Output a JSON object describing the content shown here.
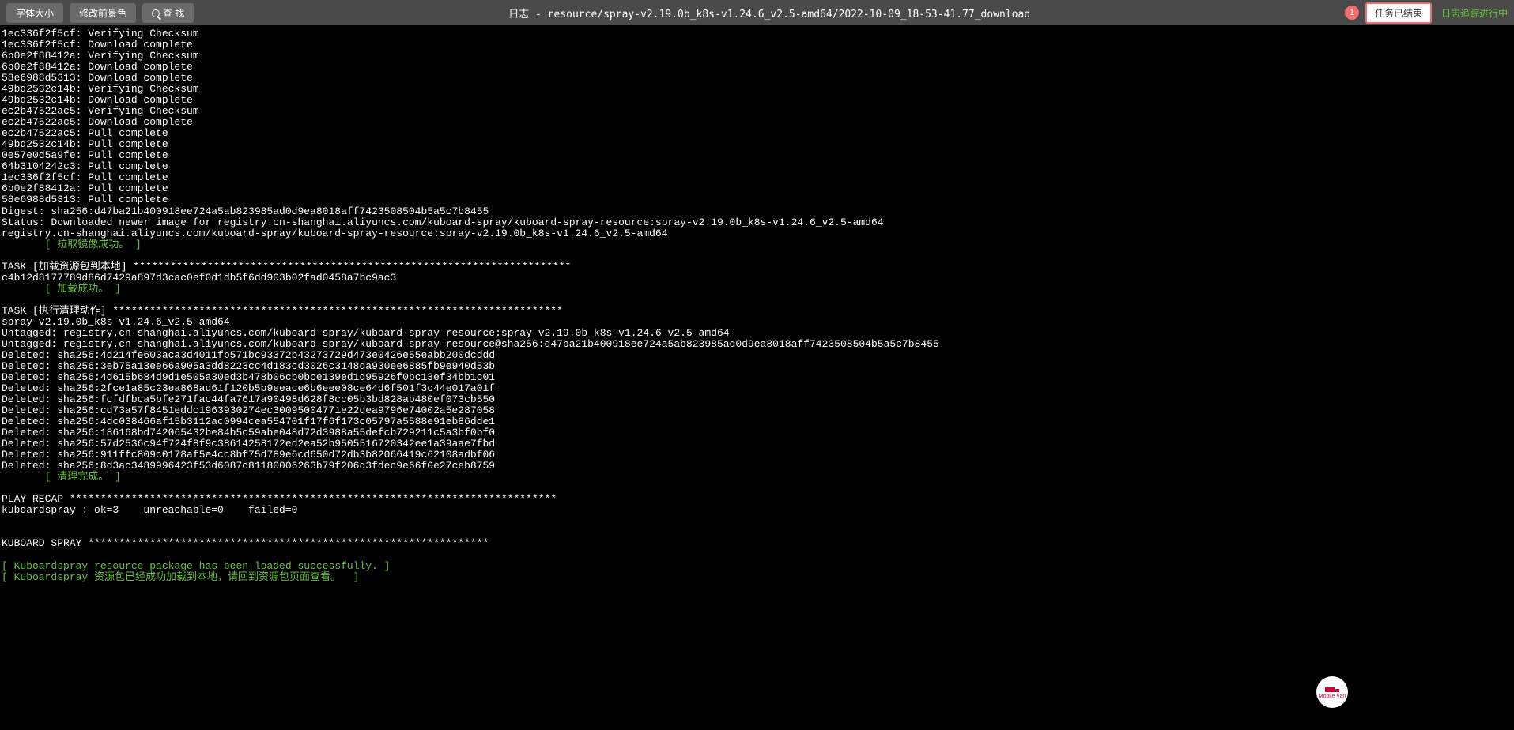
{
  "toolbar": {
    "font_size": "字体大小",
    "change_fg": "修改前景色",
    "search": "查 找",
    "title": "日志 - resource/spray-v2.19.0b_k8s-v1.24.6_v2.5-amd64/2022-10-09_18-53-41.77_download",
    "badge_count": "1",
    "task_end": "任务已结束",
    "tracking": "日志追踪进行中"
  },
  "float_label": "Mobile Van",
  "terminal": {
    "lines": [
      {
        "t": "1ec336f2f5cf: Verifying Checksum"
      },
      {
        "t": "1ec336f2f5cf: Download complete"
      },
      {
        "t": "6b0e2f88412a: Verifying Checksum"
      },
      {
        "t": "6b0e2f88412a: Download complete"
      },
      {
        "t": "58e6988d5313: Download complete"
      },
      {
        "t": "49bd2532c14b: Verifying Checksum"
      },
      {
        "t": "49bd2532c14b: Download complete"
      },
      {
        "t": "ec2b47522ac5: Verifying Checksum"
      },
      {
        "t": "ec2b47522ac5: Download complete"
      },
      {
        "t": "ec2b47522ac5: Pull complete"
      },
      {
        "t": "49bd2532c14b: Pull complete"
      },
      {
        "t": "0e57e0d5a9fe: Pull complete"
      },
      {
        "t": "64b3104242c3: Pull complete"
      },
      {
        "t": "1ec336f2f5cf: Pull complete"
      },
      {
        "t": "6b0e2f88412a: Pull complete"
      },
      {
        "t": "58e6988d5313: Pull complete"
      },
      {
        "t": "Digest: sha256:d47ba21b400918ee724a5ab823985ad0d9ea8018aff7423508504b5a5c7b8455"
      },
      {
        "t": "Status: Downloaded newer image for registry.cn-shanghai.aliyuncs.com/kuboard-spray/kuboard-spray-resource:spray-v2.19.0b_k8s-v1.24.6_v2.5-amd64"
      },
      {
        "t": "registry.cn-shanghai.aliyuncs.com/kuboard-spray/kuboard-spray-resource:spray-v2.19.0b_k8s-v1.24.6_v2.5-amd64"
      },
      {
        "t": "       [ 拉取镜像成功。 ]",
        "c": "green"
      },
      {
        "t": ""
      },
      {
        "t": "TASK [加载资源包到本地] ***********************************************************************"
      },
      {
        "t": "c4b12d8177789d86d7429a897d3cac0ef0d1db5f6dd903b02fad0458a7bc9ac3"
      },
      {
        "t": "       [ 加载成功。 ]",
        "c": "green"
      },
      {
        "t": ""
      },
      {
        "t": "TASK [执行清理动作] *************************************************************************"
      },
      {
        "t": "spray-v2.19.0b_k8s-v1.24.6_v2.5-amd64"
      },
      {
        "t": "Untagged: registry.cn-shanghai.aliyuncs.com/kuboard-spray/kuboard-spray-resource:spray-v2.19.0b_k8s-v1.24.6_v2.5-amd64"
      },
      {
        "t": "Untagged: registry.cn-shanghai.aliyuncs.com/kuboard-spray/kuboard-spray-resource@sha256:d47ba21b400918ee724a5ab823985ad0d9ea8018aff7423508504b5a5c7b8455"
      },
      {
        "t": "Deleted: sha256:4d214fe603aca3d4011fb571bc93372b43273729d473e0426e55eabb200dcddd"
      },
      {
        "t": "Deleted: sha256:3eb75a13ee66a905a3dd8223cc4d183cd3026c3148da930ee6885fb9e940d53b"
      },
      {
        "t": "Deleted: sha256:4d615b684d9d1e505a30ed3b478b06cb0bce139ed1d95926f0bc13ef34bb1c01"
      },
      {
        "t": "Deleted: sha256:2fce1a85c23ea868ad61f120b5b9eeace6b6eee08ce64d6f501f3c44e017a01f"
      },
      {
        "t": "Deleted: sha256:fcfdfbca5bfe271fac44fa7617a90498d628f8cc05b3bd828ab480ef073cb550"
      },
      {
        "t": "Deleted: sha256:cd73a57f8451eddc1963930274ec30095004771e22dea9796e74002a5e287058"
      },
      {
        "t": "Deleted: sha256:4dc038466af15b3112ac0994cea554701f17f6f173c05797a5588e91eb86dde1"
      },
      {
        "t": "Deleted: sha256:186168bd742065432be84b5c59abe048d72d3988a55defcb729211c5a3bf0bf0"
      },
      {
        "t": "Deleted: sha256:57d2536c94f724f8f9c38614258172ed2ea52b9505516720342ee1a39aae7fbd"
      },
      {
        "t": "Deleted: sha256:911ffc809c0178af5e4cc8bf75d789e6cd650d72db3b82066419c62108adbf06"
      },
      {
        "t": "Deleted: sha256:8d3ac3489996423f53d6087c81180006263b79f206d3fdec9e66f0e27ceb8759"
      },
      {
        "t": "       [ 清理完成。 ]",
        "c": "green"
      },
      {
        "t": ""
      },
      {
        "t": "PLAY RECAP *******************************************************************************"
      },
      {
        "t": "kuboardspray : ok=3    unreachable=0    failed=0"
      },
      {
        "t": ""
      },
      {
        "t": ""
      },
      {
        "t": "KUBOARD SPRAY *****************************************************************"
      },
      {
        "t": ""
      },
      {
        "t": "[ Kuboardspray resource package has been loaded successfully. ]",
        "c": "green"
      },
      {
        "t": "[ Kuboardspray 资源包已经成功加载到本地，请回到资源包页面查看。  ]",
        "c": "green"
      }
    ]
  }
}
